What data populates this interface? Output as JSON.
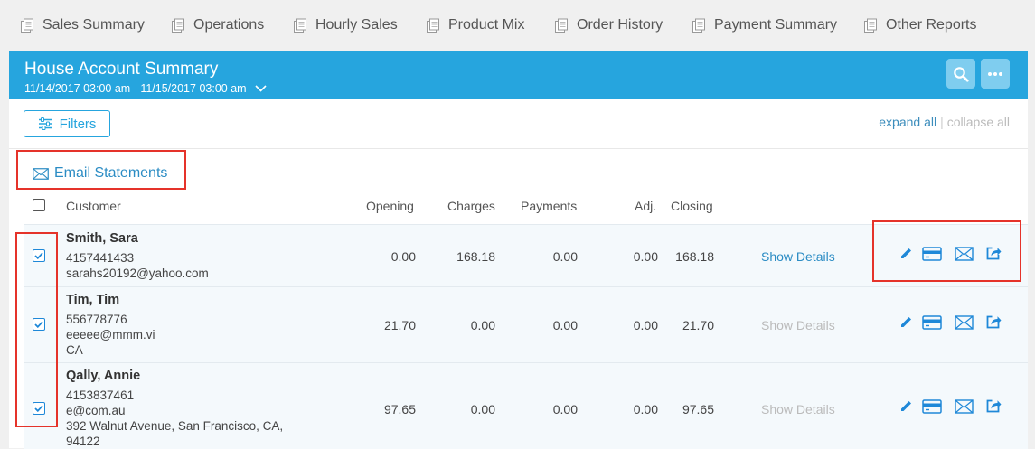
{
  "nav": {
    "tabs": [
      {
        "label": "Sales Summary"
      },
      {
        "label": "Operations"
      },
      {
        "label": "Hourly Sales"
      },
      {
        "label": "Product Mix"
      },
      {
        "label": "Order History"
      },
      {
        "label": "Payment Summary"
      },
      {
        "label": "Other Reports"
      }
    ]
  },
  "header": {
    "title": "House Account Summary",
    "date_range": "11/14/2017 03:00 am - 11/15/2017 03:00 am"
  },
  "toolbar": {
    "filters_label": "Filters",
    "expand_all": "expand all",
    "separator": "|",
    "collapse_all": "collapse all"
  },
  "email_statements_label": "Email Statements",
  "table": {
    "columns": {
      "customer": "Customer",
      "opening": "Opening",
      "charges": "Charges",
      "payments": "Payments",
      "adj": "Adj.",
      "closing": "Closing"
    },
    "rows": [
      {
        "name": "Smith, Sara",
        "lines": [
          "4157441433",
          "sarahs20192@yahoo.com"
        ],
        "opening": "0.00",
        "charges": "168.18",
        "payments": "0.00",
        "adj": "0.00",
        "closing": "168.18",
        "details_label": "Show Details",
        "details_enabled": true,
        "checked": true
      },
      {
        "name": "Tim, Tim",
        "lines": [
          "556778776",
          "eeeee@mmm.vi",
          "CA"
        ],
        "opening": "21.70",
        "charges": "0.00",
        "payments": "0.00",
        "adj": "0.00",
        "closing": "21.70",
        "details_label": "Show Details",
        "details_enabled": false,
        "checked": true
      },
      {
        "name": "Qally, Annie",
        "lines": [
          "4153837461",
          "e@com.au",
          "392 Walnut Avenue, San Francisco, CA,",
          "94122"
        ],
        "opening": "97.65",
        "charges": "0.00",
        "payments": "0.00",
        "adj": "0.00",
        "closing": "97.65",
        "details_label": "Show Details",
        "details_enabled": false,
        "checked": true
      }
    ]
  },
  "colors": {
    "header_bg": "#26a5de",
    "link": "#2b8cc4",
    "highlight_box": "#e5332a"
  }
}
